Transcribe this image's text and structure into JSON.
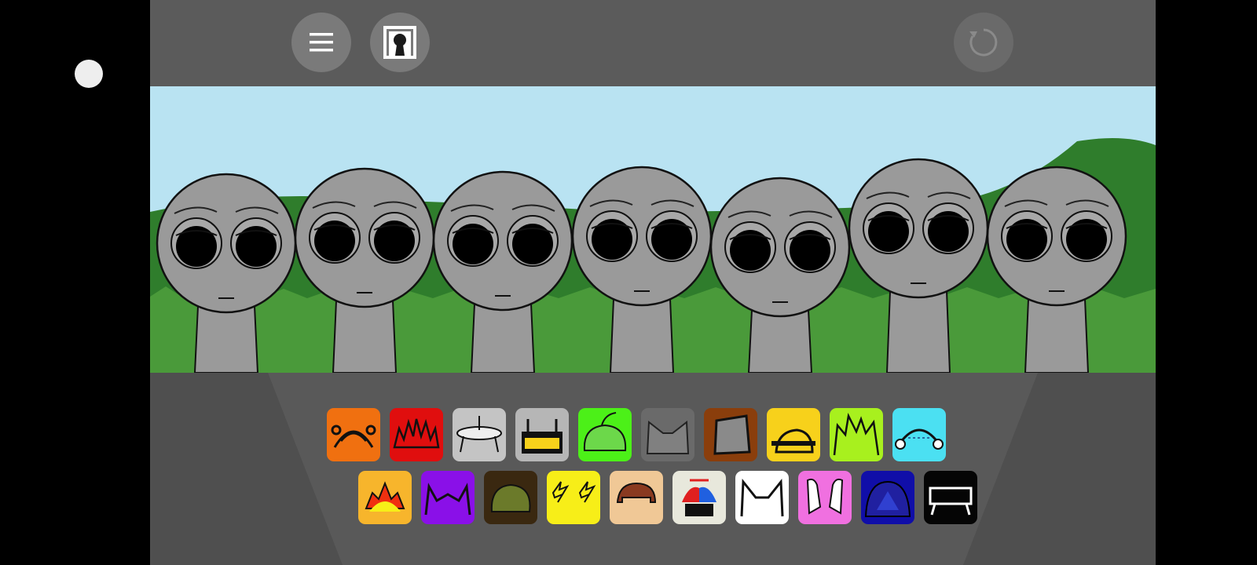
{
  "topbar": {
    "buttons": [
      {
        "name": "menu",
        "icon": "hamburger-menu-icon"
      },
      {
        "name": "avatar",
        "icon": "portrait-icon"
      },
      {
        "name": "reset",
        "icon": "refresh-icon"
      }
    ]
  },
  "stage": {
    "performer_count": 7,
    "sky_color": "#b9e3f2",
    "grass_color": "#4a9a3a",
    "hill_color": "#2f7d2c",
    "performer_color": "#9a9a9a"
  },
  "palette": {
    "row1": [
      {
        "name": "orange-antenna-sound",
        "bg": "#f07010"
      },
      {
        "name": "red-spiky-sound",
        "bg": "#e00e0e"
      },
      {
        "name": "silver-ufo-sound",
        "bg": "#c4c4c4"
      },
      {
        "name": "grey-headphones-sound",
        "bg": "#b6b6b6"
      },
      {
        "name": "green-leaf-sound",
        "bg": "#4cf018"
      },
      {
        "name": "dark-cat-ears-sound",
        "bg": "#6a6a6a"
      },
      {
        "name": "brown-bucket-sound",
        "bg": "#8a3e0c"
      },
      {
        "name": "yellow-bed-sound",
        "bg": "#f7d11b"
      },
      {
        "name": "lime-spiky-hair-sound",
        "bg": "#a8f01e"
      },
      {
        "name": "cyan-headphones-sound",
        "bg": "#4be0f2"
      }
    ],
    "row2": [
      {
        "name": "sunrise-sound",
        "bg": "#f7b52c"
      },
      {
        "name": "purple-horns-sound",
        "bg": "#8a10e8"
      },
      {
        "name": "olive-mound-sound",
        "bg": "#3a2810"
      },
      {
        "name": "yellow-lightning-sound",
        "bg": "#f7ee18"
      },
      {
        "name": "brown-hair-sound",
        "bg": "#f0c896"
      },
      {
        "name": "propeller-cap-sound",
        "bg": "#e8e8dc"
      },
      {
        "name": "white-cat-ears-sound",
        "bg": "#ffffff"
      },
      {
        "name": "pink-bunny-ears-sound",
        "bg": "#f070e0"
      },
      {
        "name": "navy-dome-sound",
        "bg": "#100ea8"
      },
      {
        "name": "black-bench-sound",
        "bg": "#050505"
      }
    ]
  }
}
